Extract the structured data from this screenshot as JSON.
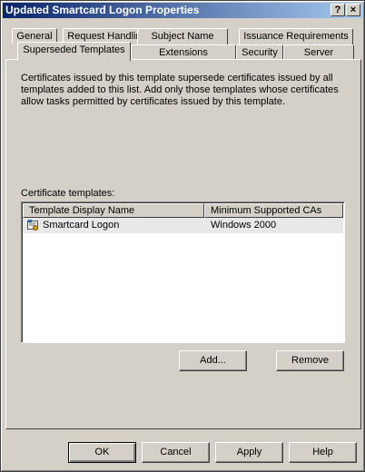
{
  "window": {
    "title": "Updated Smartcard Logon Properties",
    "help_glyph": "?",
    "close_glyph": "×"
  },
  "tabs_row1": [
    "General",
    "Request Handling",
    "Subject Name",
    "Issuance Requirements"
  ],
  "tabs_row2": [
    "Superseded Templates",
    "Extensions",
    "Security",
    "Server"
  ],
  "active_tab": "Superseded Templates",
  "panel": {
    "description": "Certificates issued by this template supersede certificates issued by all templates added to this list. Add only those templates whose certificates allow tasks permitted by certificates issued by this template.",
    "list_label": "Certificate templates:",
    "columns": [
      "Template Display Name",
      "Minimum Supported CAs"
    ],
    "rows": [
      {
        "name": "Smartcard Logon",
        "ca": "Windows 2000",
        "icon": "certificate-template-icon"
      }
    ],
    "add_button": "Add...",
    "remove_button": "Remove"
  },
  "footer": {
    "ok": "OK",
    "cancel": "Cancel",
    "apply": "Apply",
    "help": "Help"
  }
}
